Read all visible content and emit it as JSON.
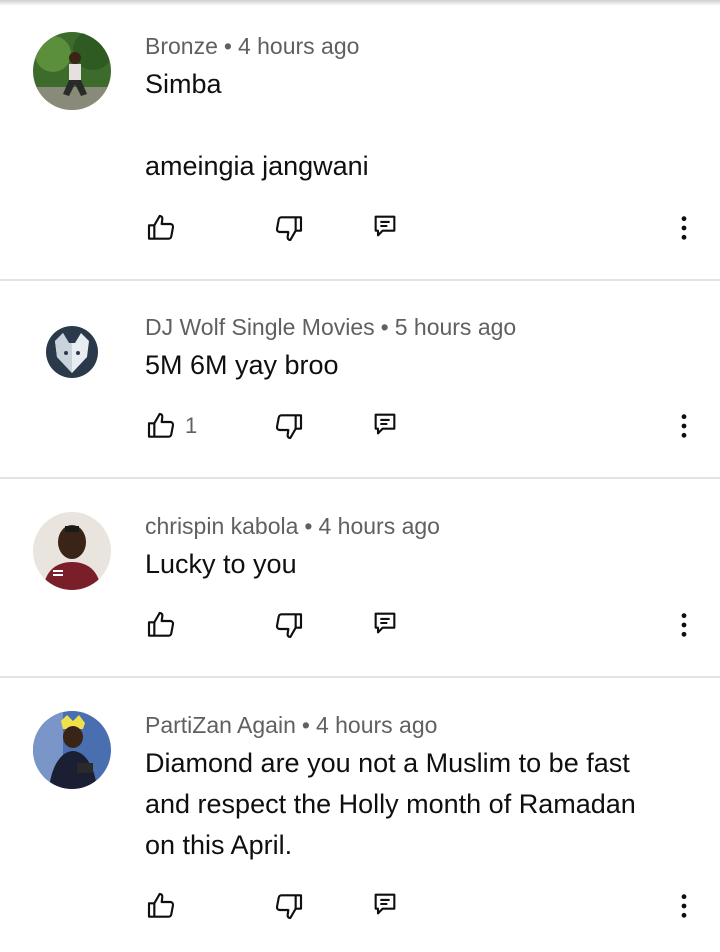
{
  "comments": [
    {
      "author": "Bronze",
      "time": "4 hours ago",
      "separator": "•",
      "text_lines": [
        "Simba",
        "",
        "ameingia jangwani"
      ],
      "likes": "",
      "avatar_icon": "user-photo-avatar"
    },
    {
      "author": "DJ Wolf Single Movies",
      "time": "5 hours ago",
      "separator": "•",
      "text_lines": [
        "5M 6M yay broo"
      ],
      "likes": "1",
      "avatar_icon": "wolf-logo-avatar"
    },
    {
      "author": "chrispin kabola",
      "time": "4 hours ago",
      "separator": "•",
      "text_lines": [
        "Lucky to you"
      ],
      "likes": "",
      "avatar_icon": "user-photo-avatar"
    },
    {
      "author": "PartiZan Again",
      "time": "4 hours ago",
      "separator": "•",
      "text_lines": [
        "Diamond are you not a Muslim to be fast",
        "and respect the Holly month of Ramadan",
        "on this April."
      ],
      "likes": "",
      "avatar_icon": "user-photo-avatar"
    }
  ],
  "icons": {
    "like": "thumbs-up-icon",
    "dislike": "thumbs-down-icon",
    "reply": "reply-icon",
    "more": "more-vert-icon"
  },
  "colors": {
    "meta_text": "#606060",
    "body_text": "#0f0f0f",
    "divider": "#e3e3e3"
  }
}
